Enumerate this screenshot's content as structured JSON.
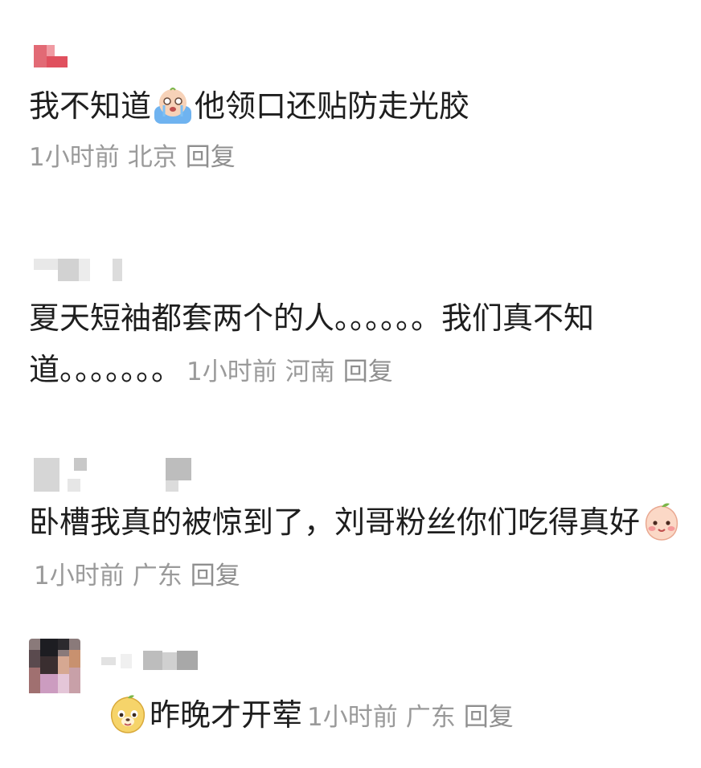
{
  "comments": [
    {
      "text_before": "我不知道",
      "emoji": "crying-emoji",
      "text_after": "他领口还贴防走光胶",
      "time": "1小时前",
      "location": "北京",
      "reply": "回复"
    },
    {
      "text": "夏天短袖都套两个的人。。。。。。我们真不知道。。。。。。。",
      "time": "1小时前",
      "location": "河南",
      "reply": "回复"
    },
    {
      "text": "卧槽我真的被惊到了，刘哥粉丝你们吃得真好",
      "emoji": "shy-peach-emoji",
      "time": "1小时前",
      "location": "广东",
      "reply": "回复"
    },
    {
      "emoji": "dog-emoji",
      "text": "昨晚才开荤",
      "time": "1小时前",
      "location": "广东",
      "reply": "回复"
    }
  ],
  "colors": {
    "text": "#1e1e1e",
    "meta": "#9a9a9a",
    "pixelated_red": "#e06070"
  }
}
